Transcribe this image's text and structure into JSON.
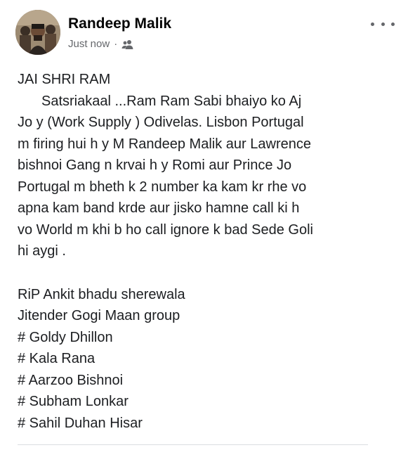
{
  "post": {
    "author": "Randeep Malik",
    "timestamp": "Just now",
    "separator": "·",
    "audience_icon": "friends-icon",
    "more_icon": "more-options-icon",
    "lines": [
      "JAI SHRI RAM",
      "Satsriakaal ...Ram Ram Sabi bhaiyo ko Aj",
      "Jo y (Work Supply ) Odivelas.  Lisbon Portugal",
      "m firing hui h y M Randeep Malik aur Lawrence",
      "bishnoi Gang n krvai h y Romi aur Prince Jo",
      "Portugal m bheth k 2 number ka kam kr rhe vo",
      "apna kam  band krde aur jisko hamne call ki h",
      "vo World m khi b ho call ignore k bad Sede Goli",
      "hi aygi ."
    ],
    "tags": [
      "RiP Ankit bhadu sherewala",
      "Jitender Gogi Maan group",
      "# Goldy Dhillon",
      "# Kala Rana",
      "# Aarzoo Bishnoi",
      "# Subham Lonkar",
      "# Sahil Duhan Hisar"
    ]
  }
}
